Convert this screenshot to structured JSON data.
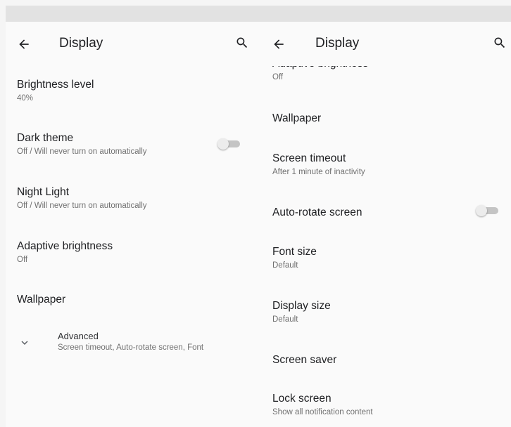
{
  "left_panel": {
    "title": "Display",
    "icons": {
      "back": "arrow-left-icon",
      "search": "search-icon",
      "expand": "chevron-down-icon"
    },
    "items": [
      {
        "title": "Brightness level",
        "summary": "40%"
      },
      {
        "title": "Dark theme",
        "summary": "Off / Will never turn on automatically",
        "toggle": false
      },
      {
        "title": "Night Light",
        "summary": "Off / Will never turn on automatically"
      },
      {
        "title": "Adaptive brightness",
        "summary": "Off"
      },
      {
        "title": "Wallpaper"
      }
    ],
    "advanced": {
      "title": "Advanced",
      "summary": "Screen timeout, Auto-rotate screen, Font"
    }
  },
  "right_panel": {
    "title": "Display",
    "icons": {
      "back": "arrow-left-icon",
      "search": "search-icon"
    },
    "items": [
      {
        "title": "Adaptive brightness",
        "summary": "Off"
      },
      {
        "title": "Wallpaper"
      },
      {
        "title": "Screen timeout",
        "summary": "After 1 minute of inactivity"
      },
      {
        "title": "Auto-rotate screen",
        "toggle": false
      },
      {
        "title": "Font size",
        "summary": "Default"
      },
      {
        "title": "Display size",
        "summary": "Default"
      },
      {
        "title": "Screen saver"
      },
      {
        "title": "Lock screen",
        "summary": "Show all notification content"
      }
    ]
  },
  "colors": {
    "background": "#fafafa",
    "status_bar": "#e2e2e2",
    "primary_text": "#202124",
    "secondary_text": "#707070",
    "toggle_track_off": "#c4c4c4",
    "toggle_thumb_off": "#ececec"
  }
}
